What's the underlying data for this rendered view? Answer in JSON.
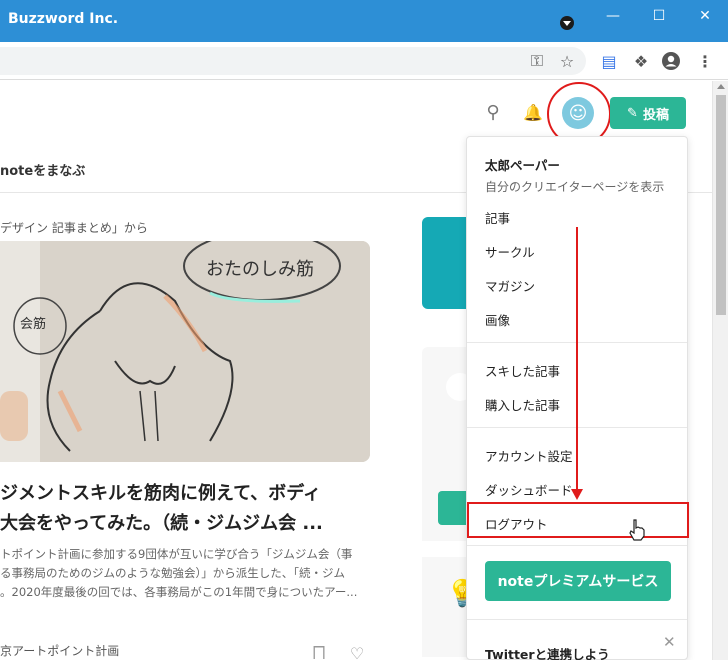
{
  "window": {
    "title": "Buzzword Inc."
  },
  "browser_toolbar": {
    "icons": [
      "key-icon",
      "star-icon",
      "reading-list-icon",
      "extensions-icon",
      "profile-icon",
      "more-icon"
    ]
  },
  "header": {
    "nav_label": "noteをまなぶ",
    "post_button_label": "投稿"
  },
  "article": {
    "from_label": "デザイン 記事まとめ」から",
    "hero_text": "おたのしみ筋",
    "hero_small": "会筋",
    "headline_line1": "ジメントスキルを筋肉に例えて、ボディ",
    "headline_line2": "大会をやってみた。（続・ジムジム会 ...",
    "excerpt_line1": "トポイント計画に参加する9団体が互いに学び合う「ジムジム会（事",
    "excerpt_line2": "る事務局のためのジムのような勉強会）」から派生した、「続・ジム",
    "excerpt_line3": "。2020年度最後の回では、各事務局がこの1年間で身についたアー...",
    "author": "京アートポイント計画"
  },
  "user_menu": {
    "user_name": "太郎ペーパー",
    "user_sub": "自分のクリエイターページを表示",
    "items_group1": [
      "記事",
      "サークル",
      "マガジン",
      "画像"
    ],
    "items_group2": [
      "スキした記事",
      "購入した記事"
    ],
    "items_group3": [
      "アカウント設定",
      "ダッシュボード",
      "ログアウト"
    ],
    "premium_button": "noteプレミアムサービス",
    "twitter_prompt": "Twitterと連携しよう"
  },
  "colors": {
    "accent": "#2cb696",
    "titlebar": "#2d8fd6",
    "annotation_red": "#e01b1b"
  }
}
